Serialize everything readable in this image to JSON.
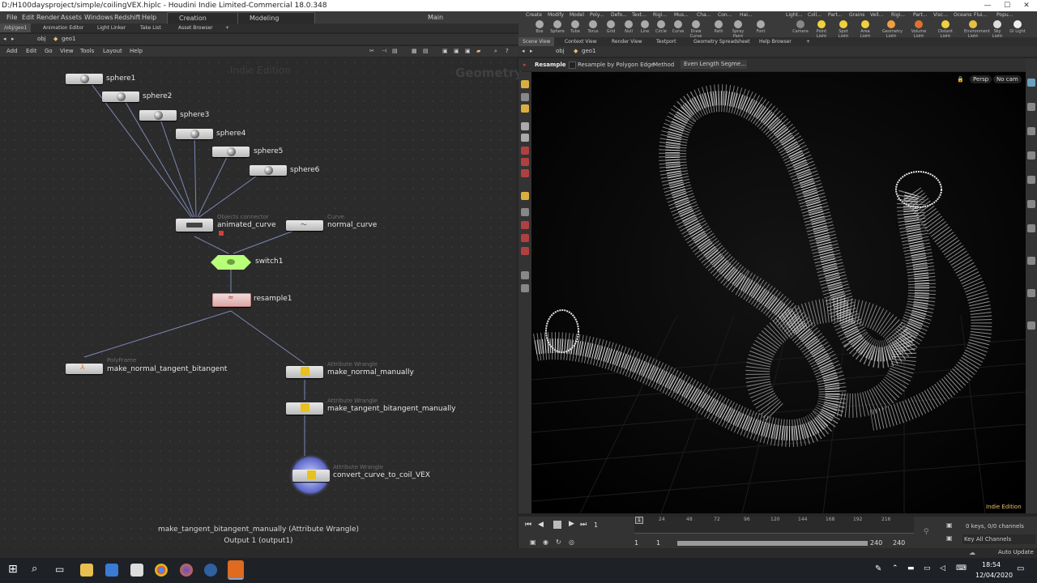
{
  "window": {
    "title": "D:/H100daysproject/simple/coilingVEX.hiplc - Houdini Indie Limited-Commercial 18.0.348",
    "min": "—",
    "max": "☐",
    "close": "✕"
  },
  "menubar": {
    "items": [
      "File",
      "Edit",
      "Render",
      "Assets",
      "Windows",
      "Redshift",
      "Help"
    ],
    "desktop1": "Creation",
    "desktop2": "Modeling",
    "main": "Main"
  },
  "left_tabs": [
    "/obj/geo1",
    "Animation Editor",
    "Light Linker",
    "Take List",
    "Asset Browser"
  ],
  "left_path": {
    "obj": "obj",
    "geo": "geo1"
  },
  "net_menu": [
    "Add",
    "Edit",
    "Go",
    "View",
    "Tools",
    "Layout",
    "Help"
  ],
  "network": {
    "watermark_edition": "Indie Edition",
    "watermark_context": "Geometry",
    "nodes": {
      "sphere1": "sphere1",
      "sphere2": "sphere2",
      "sphere3": "sphere3",
      "sphere4": "sphere4",
      "sphere5": "sphere5",
      "sphere6": "sphere6",
      "animated_curve": "animated_curve",
      "animated_curve_type": "Objects connector",
      "normal_curve": "normal_curve",
      "normal_curve_type": "Curve",
      "switch1": "switch1",
      "resample1": "resample1",
      "polyframe": "make_normal_tangent_bitangent",
      "polyframe_type": "PolyFrame",
      "wrangle1": "make_normal_manually",
      "wrangle1_type": "Attribute Wrangle",
      "wrangle2": "make_tangent_bitangent_manually",
      "wrangle2_type": "Attribute Wrangle",
      "wrangle3": "convert_curve_to_coil_VEX",
      "wrangle3_type": "Attribute Wrangle"
    },
    "info_line1": "make_tangent_bitangent_manually (Attribute Wrangle)",
    "info_line2": "Output 1 (output1)"
  },
  "shelf": {
    "tabs": [
      "Create",
      "Modify",
      "Model",
      "Poly...",
      "Defo...",
      "Text...",
      "Rigi...",
      "Mus...",
      "Cha...",
      "Con...",
      "Hai...",
      "Light...",
      "Coll...",
      "Part...",
      "Grains",
      "Vell...",
      "Rigi...",
      "Part...",
      "Visc...",
      "Oceans",
      "Flui...",
      "Popu..."
    ],
    "tools": [
      "Box",
      "Sphere",
      "Tube",
      "Torus",
      "Grid",
      "Null",
      "Line",
      "Circle",
      "Curve",
      "Draw Curve",
      "Path",
      "Spray Paint",
      "Font"
    ],
    "light_tools": [
      "Camera",
      "Point Light",
      "Spot Light",
      "Area Light",
      "Geometry Light",
      "Volume Light",
      "Distant Light",
      "Environment Light",
      "Sky Light",
      "GI Light"
    ]
  },
  "right_tabs": [
    "Scene View",
    "Context View",
    "Render View",
    "Textport",
    "Geometry Spreadsheet",
    "Help Browser"
  ],
  "right_path": {
    "obj": "obj",
    "geo": "geo1"
  },
  "viewport_toolbar": {
    "node": "Resample",
    "option": "Resample by Polygon Edge",
    "method_label": "Method",
    "method_value": "Even Length Segme..."
  },
  "viewport": {
    "persp": "Persp",
    "cam": "No cam",
    "edition": "Indie Edition"
  },
  "timeline": {
    "frame": "1",
    "ticks": [
      "1",
      "24",
      "48",
      "72",
      "96",
      "120",
      "144",
      "168",
      "192",
      "216"
    ],
    "start": "1",
    "start2": "1",
    "end": "240",
    "end2": "240",
    "keys": "0 keys, 0/0 channels",
    "key_all": "Key All Channels",
    "auto_update": "Auto Update"
  },
  "taskbar": {
    "time": "18:54",
    "date": "12/04/2020"
  },
  "colors": {
    "background": "#2b2b2b",
    "switch_node": "#b8ff7a",
    "resample_node": "#f0c8c8",
    "wrangle_node": "#e8e8e8"
  }
}
